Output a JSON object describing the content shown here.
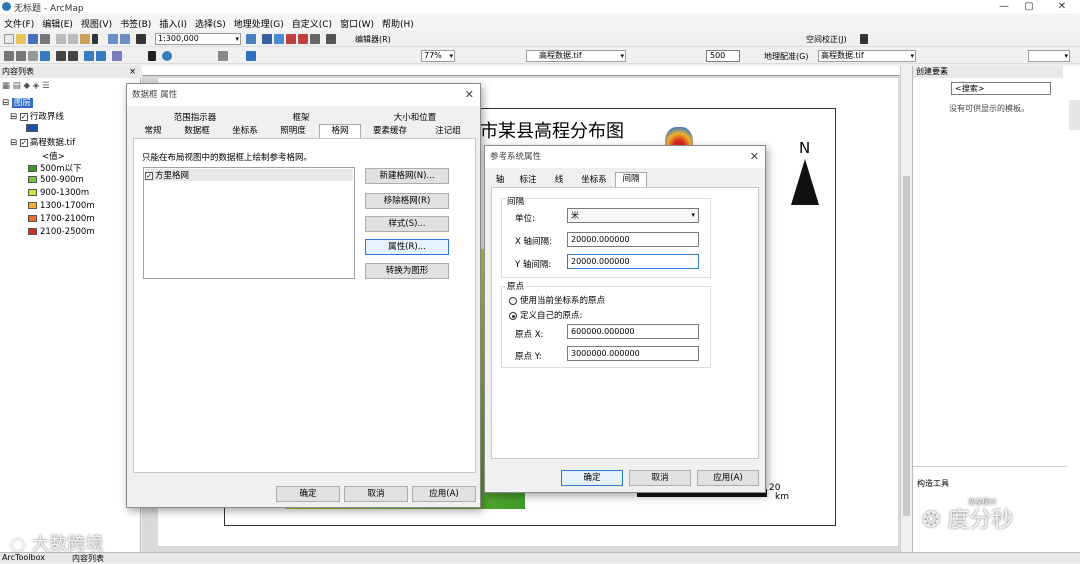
{
  "window": {
    "title": "无标题 - ArcMap"
  },
  "menu": [
    "文件(F)",
    "编辑(E)",
    "视图(V)",
    "书签(B)",
    "插入(I)",
    "选择(S)",
    "地理处理(G)",
    "自定义(C)",
    "窗口(W)",
    "帮助(H)"
  ],
  "toolbar": {
    "scale": "1:300,000",
    "editor_label": "编辑器(R)",
    "spatial_adjust": "空间校正(J)",
    "zoom": "77%",
    "layer_combo": "高程数据.tif",
    "value_500": "500",
    "georef": "地理配准(G)",
    "georef_layer": "高程数据.tif"
  },
  "toc": {
    "title": "内容列表",
    "group": "图层",
    "layer1": "行政界线",
    "layer2": "高程数据.tif",
    "value_label": "<值>",
    "classes": [
      {
        "label": "500m以下",
        "color": "#3a9a2a"
      },
      {
        "label": "500-900m",
        "color": "#7cc23c"
      },
      {
        "label": "900-1300m",
        "color": "#d6e03a"
      },
      {
        "label": "1300-1700m",
        "color": "#f0b22a"
      },
      {
        "label": "1700-2100m",
        "color": "#e8702a"
      },
      {
        "label": "2100-2500m",
        "color": "#d42a20"
      }
    ]
  },
  "map": {
    "title": "市某县高程分布图",
    "north": "N",
    "scale_value": "20",
    "scale_unit": "km"
  },
  "right_panel": {
    "title": "创建要素",
    "search": "<搜索>",
    "empty": "没有可供显示的模板。",
    "tools_title": "构造工具"
  },
  "statusbar": {
    "tab1": "ArcToolbox",
    "tab2": "内容列表"
  },
  "frame_dialog": {
    "title": "数据框 属性",
    "tabs_row1": [
      "范围指示器",
      "框架",
      "大小和位置"
    ],
    "tabs_row2": [
      "常规",
      "数据框",
      "坐标系",
      "照明度",
      "格网",
      "要素缓存",
      "注记组"
    ],
    "info": "只能在布局视图中的数据框上绘制参考格网。",
    "grid_item": "方里格网",
    "buttons": {
      "new": "新建格网(N)...",
      "remove": "移除格网(R)",
      "style": "样式(S)...",
      "props": "属性(R)...",
      "convert": "转换为图形"
    },
    "ok": "确定",
    "cancel": "取消",
    "apply": "应用(A)"
  },
  "ref_dialog": {
    "title": "参考系统属性",
    "tabs": [
      "轴",
      "标注",
      "线",
      "坐标系",
      "间隔"
    ],
    "interval_group": "间隔",
    "unit_label": "单位:",
    "unit_value": "米",
    "x_label": "X 轴间隔:",
    "x_value": "20000.000000",
    "y_label": "Y 轴间隔:",
    "y_value": "20000.000000",
    "origin_group": "原点",
    "opt1": "使用当前坐标系的原点",
    "opt2": "定义自己的原点:",
    "ox_label": "原点 X:",
    "ox_value": "600000.000000",
    "oy_label": "原点 Y:",
    "oy_value": "3000000.000000",
    "ok": "确定",
    "cancel": "取消",
    "apply": "应用(A)"
  },
  "watermarks": {
    "left": "大数跨境",
    "right": "度分秒",
    "right_small": "洗澡横州"
  }
}
